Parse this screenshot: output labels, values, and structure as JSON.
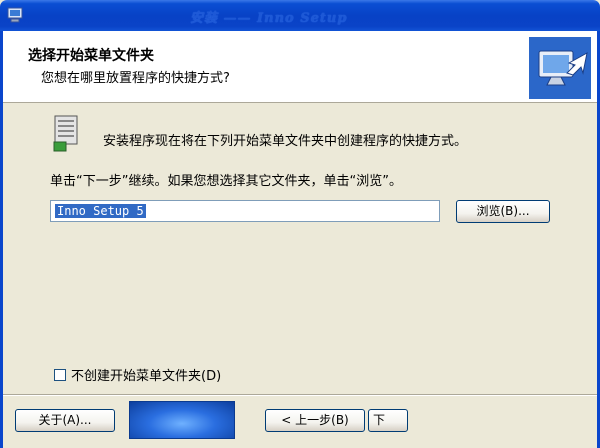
{
  "window": {
    "title": "安装 —— Inno Setup"
  },
  "header": {
    "title": "选择开始菜单文件夹",
    "subtitle": "您想在哪里放置程序的快捷方式?"
  },
  "main": {
    "description": "安装程序现在将在下列开始菜单文件夹中创建程序的快捷方式。",
    "instruction": "单击“下一步”继续。如果您想选择其它文件夹，单击“浏览”。",
    "folder_value": "Inno Setup 5",
    "browse_label": "浏览(B)...",
    "no_folder_label": "不创建开始菜单文件夹(D)",
    "no_folder_checked": false
  },
  "footer": {
    "about_label": "关于(A)...",
    "back_label": "< 上一步(B)",
    "next_label": "下"
  },
  "icons": {
    "window_icon": "setup-computer-icon",
    "header_icon": "monitor-arrow-icon",
    "folder_icon": "start-menu-folder-icon"
  },
  "colors": {
    "titlebar": "#0a46cc",
    "selection": "#316ac5",
    "dialog_bg": "#ece9d8"
  }
}
